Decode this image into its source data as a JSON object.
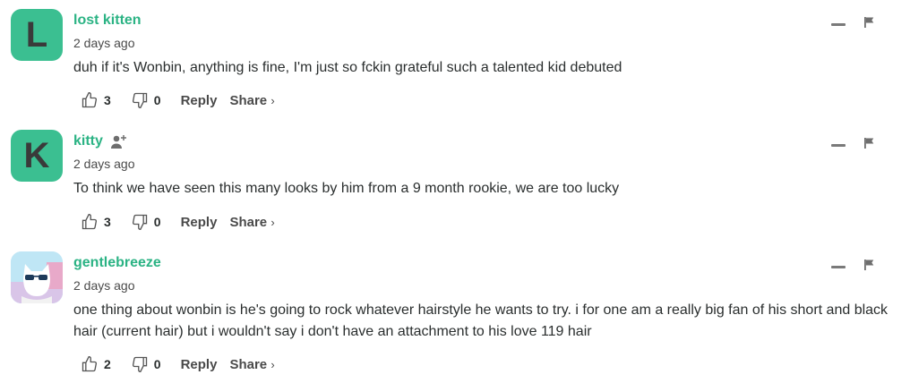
{
  "comments": [
    {
      "author": "lost kitten",
      "avatar_letter": "L",
      "time": "2 days ago",
      "text": "duh if it's Wonbin, anything is fine, I'm just so fckin grateful such a talented kid debuted",
      "likes": "3",
      "dislikes": "0",
      "reply_label": "Reply",
      "share_label": "Share",
      "share_chevron": "›"
    },
    {
      "author": "kitty",
      "avatar_letter": "K",
      "time": "2 days ago",
      "text": "To think we have seen this many looks by him from a 9 month rookie, we are too lucky",
      "likes": "3",
      "dislikes": "0",
      "reply_label": "Reply",
      "share_label": "Share",
      "share_chevron": "›",
      "badge_icon": "add-user-icon"
    },
    {
      "author": "gentlebreeze",
      "avatar_icon": "cat-with-sunglasses-avatar",
      "time": "2 days ago",
      "text": "one thing about wonbin is he's going to rock whatever hairstyle he wants to try. i for one am a really big fan of his short and black hair (current hair) but i wouldn't say i don't have an attachment to his love 119 hair",
      "likes": "2",
      "dislikes": "0",
      "reply_label": "Reply",
      "share_label": "Share",
      "share_chevron": "›"
    }
  ],
  "colors": {
    "accent": "#2bb384",
    "avatar_bg": "#3bbf91",
    "text": "#2a2e2e",
    "muted": "#4a4a4a"
  }
}
